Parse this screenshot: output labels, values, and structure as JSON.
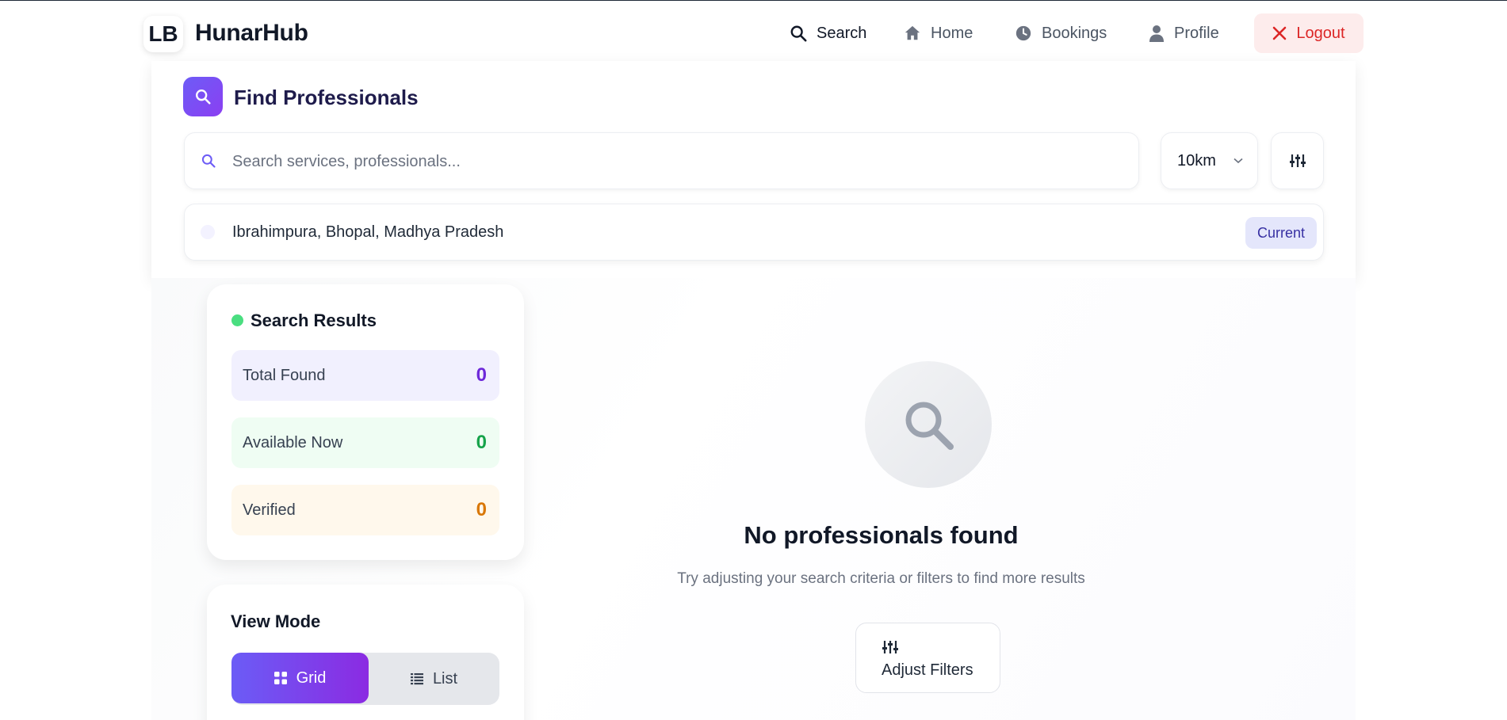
{
  "header": {
    "logo_initials": "LB",
    "brand": "HunarHub",
    "nav": [
      {
        "label": "Search",
        "icon": "search-icon"
      },
      {
        "label": "Home",
        "icon": "home-icon"
      },
      {
        "label": "Bookings",
        "icon": "clock-icon"
      },
      {
        "label": "Profile",
        "icon": "user-icon"
      }
    ],
    "logout_label": "Logout"
  },
  "search_panel": {
    "title": "Find Professionals",
    "search_placeholder": "Search services, professionals...",
    "search_value": "",
    "radius": "10km",
    "location": "Ibrahimpura, Bhopal, Madhya Pradesh",
    "location_badge": "Current"
  },
  "results": {
    "title": "Search Results",
    "stats": [
      {
        "label": "Total Found",
        "value": "0"
      },
      {
        "label": "Available Now",
        "value": "0"
      },
      {
        "label": "Verified",
        "value": "0"
      }
    ]
  },
  "view_mode": {
    "title": "View Mode",
    "options": [
      "Grid",
      "List"
    ],
    "selected": "Grid"
  },
  "empty_state": {
    "title": "No professionals found",
    "subtitle": "Try adjusting your search criteria or filters to find more results",
    "button_label": "Adjust Filters"
  },
  "colors": {
    "accent": "#6d5cf6",
    "accent_dark": "#8b2be2",
    "logout": "#dc2626",
    "available": "#16a34a",
    "verified": "#d97706"
  }
}
